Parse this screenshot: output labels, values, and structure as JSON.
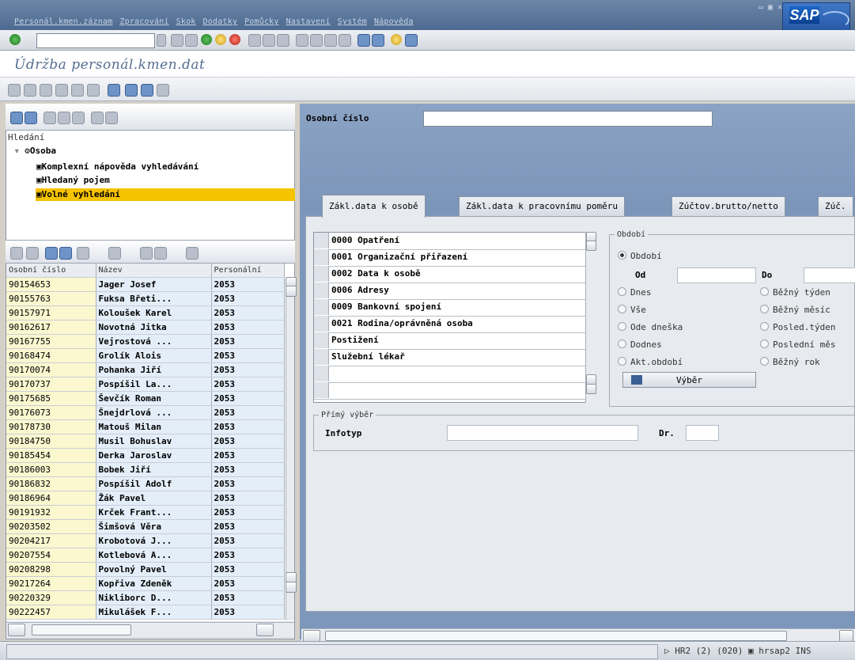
{
  "menu": [
    "Personál.kmen.záznam",
    "Zpracování",
    "Skok",
    "Dodatky",
    "Pomůcky",
    "Nastavení",
    "Systém",
    "Nápověda"
  ],
  "window": {
    "title": "Údržba personál.kmen.dat",
    "logo": "SAP"
  },
  "nav": {
    "search_label": "Hledání",
    "root": "Osoba",
    "items": [
      "Komplexní nápověda vyhledávání",
      "Hledaný pojem",
      "Volné vyhledání"
    ],
    "selected_index": 2
  },
  "table": {
    "headers": [
      "Osobní číslo",
      "Název",
      "Personální"
    ],
    "rows": [
      [
        "90154653",
        "Jager Josef",
        "2053"
      ],
      [
        "90155763",
        "Fuksa Břeti...",
        "2053"
      ],
      [
        "90157971",
        "Koloušek Karel",
        "2053"
      ],
      [
        "90162617",
        "Novotná Jitka",
        "2053"
      ],
      [
        "90167755",
        "Vejrostová ...",
        "2053"
      ],
      [
        "90168474",
        "Grolík Alois",
        "2053"
      ],
      [
        "90170074",
        "Pohanka Jiří",
        "2053"
      ],
      [
        "90170737",
        "Pospíšil La...",
        "2053"
      ],
      [
        "90175685",
        "Ševčík Roman",
        "2053"
      ],
      [
        "90176073",
        "Šnejdrlová ...",
        "2053"
      ],
      [
        "90178730",
        "Matouš Milan",
        "2053"
      ],
      [
        "90184750",
        "Musil Bohuslav",
        "2053"
      ],
      [
        "90185454",
        "Derka Jaroslav",
        "2053"
      ],
      [
        "90186003",
        "Bobek Jiří",
        "2053"
      ],
      [
        "90186832",
        "Pospíšil Adolf",
        "2053"
      ],
      [
        "90186964",
        "Žák Pavel",
        "2053"
      ],
      [
        "90191932",
        "Krček Frant...",
        "2053"
      ],
      [
        "90203502",
        "Šimšová Věra",
        "2053"
      ],
      [
        "90204217",
        "Krobotová J...",
        "2053"
      ],
      [
        "90207554",
        "Kotlebová A...",
        "2053"
      ],
      [
        "90208298",
        "Povolný Pavel",
        "2053"
      ],
      [
        "90217264",
        "Kopřiva Zdeněk",
        "2053"
      ],
      [
        "90220329",
        "Nikliborc D...",
        "2053"
      ],
      [
        "90222457",
        "Mikulášek F...",
        "2053"
      ]
    ]
  },
  "header": {
    "personnel_label": "Osobní číslo",
    "personnel_value": ""
  },
  "tabs": [
    "Zákl.data k osobě",
    "Zákl.data k pracovnímu poměru",
    "Zúčtov.brutto/netto",
    "Zúč."
  ],
  "infotypes": [
    "0000 Opatření",
    "0001 Organizační přiřazení",
    "0002 Data k osobě",
    "0006 Adresy",
    "0009 Bankovní spojení",
    "0021 Rodina/oprávněná osoba",
    "Postižení",
    "Služební lékař"
  ],
  "period": {
    "group_title": "Období",
    "radio_period": "Období",
    "from_label": "Od",
    "to_label": "Do",
    "from_value": "",
    "to_value": "",
    "left_options": [
      "Dnes",
      "Vše",
      "Ode dneška",
      "Dodnes",
      "Akt.období"
    ],
    "right_options": [
      "Běžný týden",
      "Běžný měsíc",
      "Posled.týden",
      "Poslední měs",
      "Běžný rok"
    ],
    "button": "Výběr"
  },
  "direct": {
    "group_title": "Přímý výběr",
    "infotyp_label": "Infotyp",
    "dr_label": "Dr.",
    "infotyp_value": "",
    "dr_value": ""
  },
  "status": {
    "text": "HR2 (2) (020)",
    "server": "hrsap2",
    "mode": "INS"
  },
  "colors": {
    "highlight": "#f6c300",
    "frame": "#7d97bb"
  }
}
